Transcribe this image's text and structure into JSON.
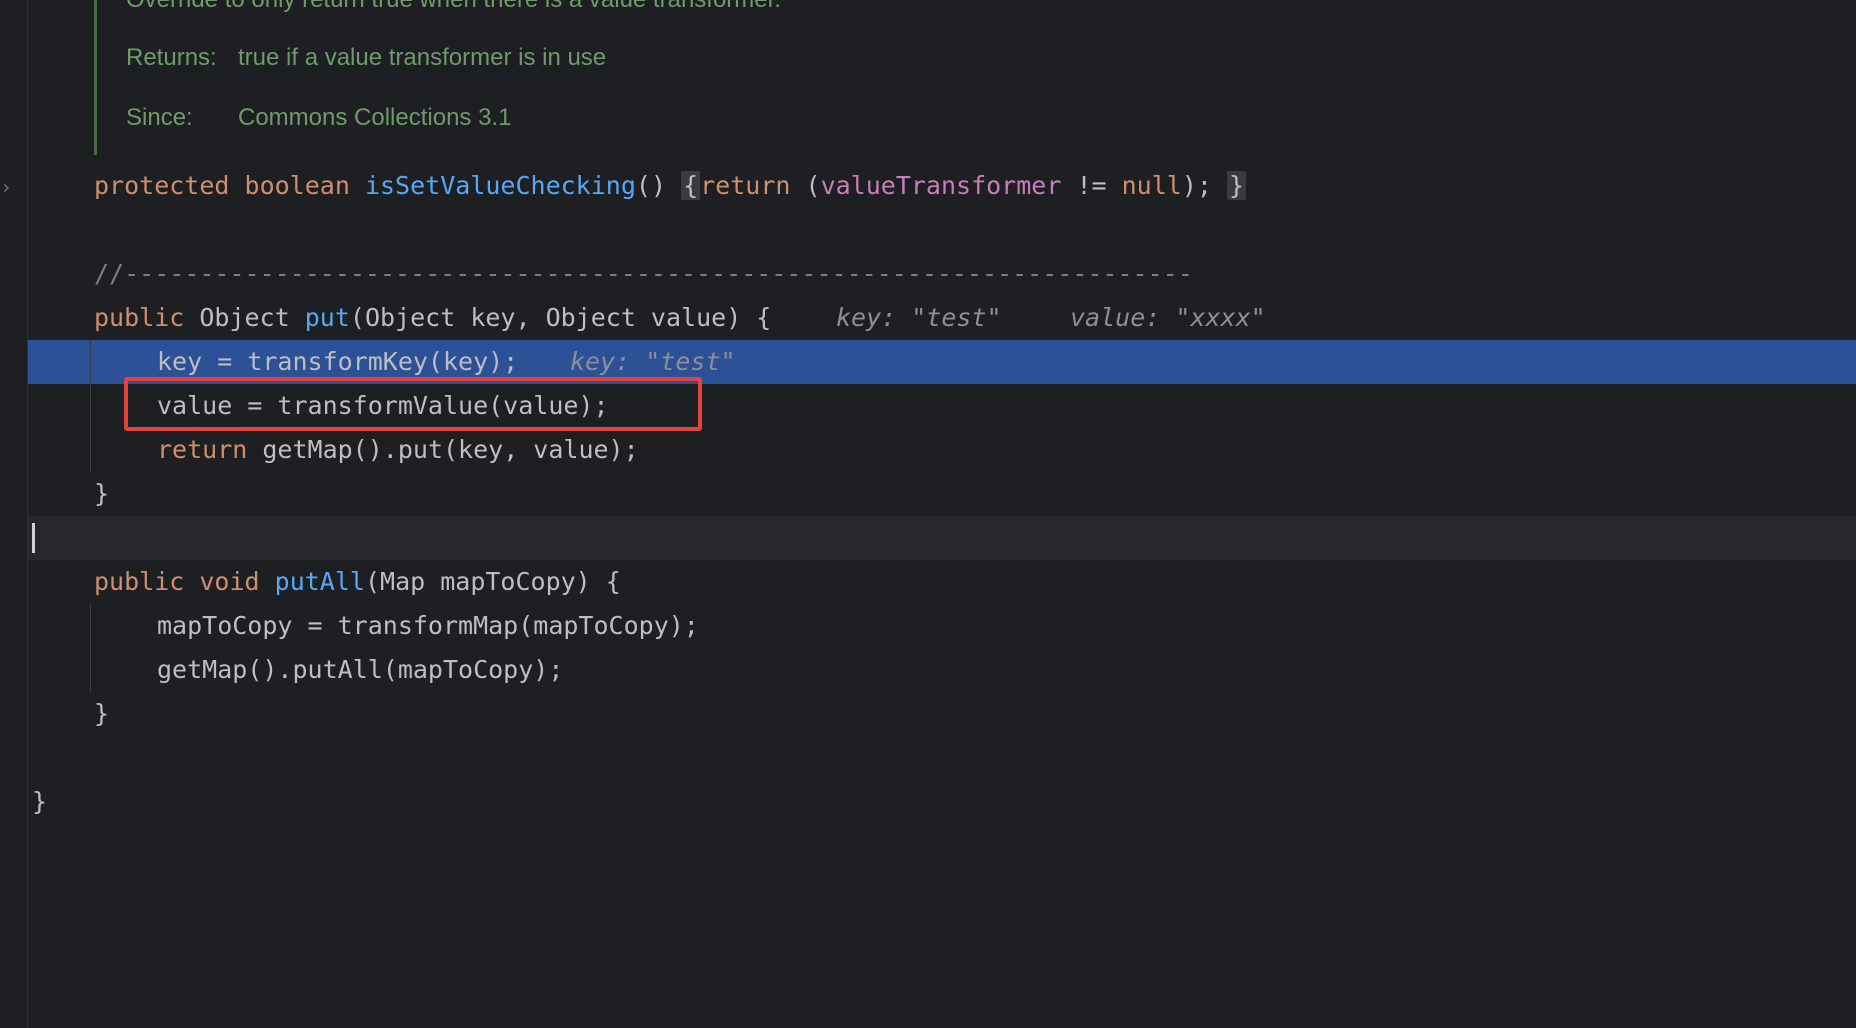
{
  "doc": {
    "top_partial": "Override to only return true when there is a value transformer.",
    "returns_label": "Returns:",
    "returns_text": "true if a value transformer is in use",
    "since_label": "Since:",
    "since_text": "Commons Collections 3.1"
  },
  "code": {
    "l1_protected": "protected",
    "l1_boolean": "boolean",
    "l1_method": "isSetValueChecking",
    "l1_paren": "()",
    "l1_open": "{",
    "l1_return": "return",
    "l1_p1": "(",
    "l1_field": "valueTransformer",
    "l1_ne": "!=",
    "l1_null": "null",
    "l1_end": ");",
    "l1_close": "}",
    "separator": "//-----------------------------------------------------------------------",
    "put_public": "public",
    "put_rest1": "Object",
    "put_name": "put",
    "put_params": "(Object key, Object value) {",
    "put_hint_key": "key: \"test\"",
    "put_hint_value": "value: \"xxxx\"",
    "key_line": "key = transformKey(key);",
    "key_hint": "key: \"test\"",
    "value_line": "value = transformValue(value);",
    "return_kw": "return",
    "return_rest": "getMap().put(key, value);",
    "close_brace": "}",
    "putall_public": "public",
    "putall_void": "void",
    "putall_name": "putAll",
    "putall_params": "(Map mapToCopy) {",
    "putall_l1": "mapToCopy = transformMap(mapToCopy);",
    "putall_l2": "getMap().putAll(mapToCopy);",
    "putall_close": "}",
    "class_close": "}"
  },
  "colors": {
    "background": "#1e1f22",
    "keyword": "#cf8e6d",
    "method": "#56a8f5",
    "field": "#c77dbb",
    "execution_line": "#2c5196",
    "annotation_box": "#e5413e"
  },
  "icons": {
    "fold": "chevron-right-icon"
  }
}
